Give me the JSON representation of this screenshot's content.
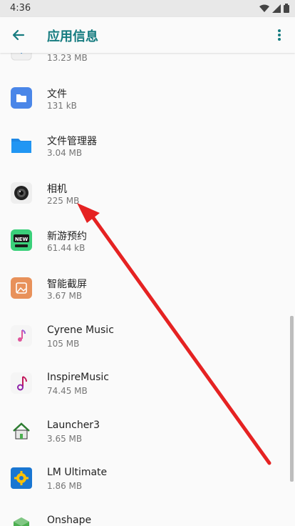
{
  "status_bar": {
    "time": "4:36"
  },
  "app_bar": {
    "title": "应用信息"
  },
  "apps": [
    {
      "name": "",
      "size": "13.23 MB",
      "icon": "gear-like-icon"
    },
    {
      "name": "文件",
      "size": "131 kB",
      "icon": "folder-icon"
    },
    {
      "name": "文件管理器",
      "size": "3.04 MB",
      "icon": "folder-icon"
    },
    {
      "name": "相机",
      "size": "225 MB",
      "icon": "camera-icon"
    },
    {
      "name": "新游预约",
      "size": "61.44 kB",
      "icon": "new-badge-icon"
    },
    {
      "name": "智能截屏",
      "size": "3.67 MB",
      "icon": "image-icon"
    },
    {
      "name": "Cyrene Music",
      "size": "105 MB",
      "icon": "music-note-icon"
    },
    {
      "name": "InspireMusic",
      "size": "74.45 MB",
      "icon": "music-note-icon"
    },
    {
      "name": "Launcher3",
      "size": "3.65 MB",
      "icon": "home-icon"
    },
    {
      "name": "LM Ultimate",
      "size": "1.86 MB",
      "icon": "gear-icon"
    },
    {
      "name": "Onshape",
      "size": "",
      "icon": "cube-icon"
    }
  ],
  "colors": {
    "accent": "#167c80",
    "annotation_arrow": "#e52222"
  }
}
